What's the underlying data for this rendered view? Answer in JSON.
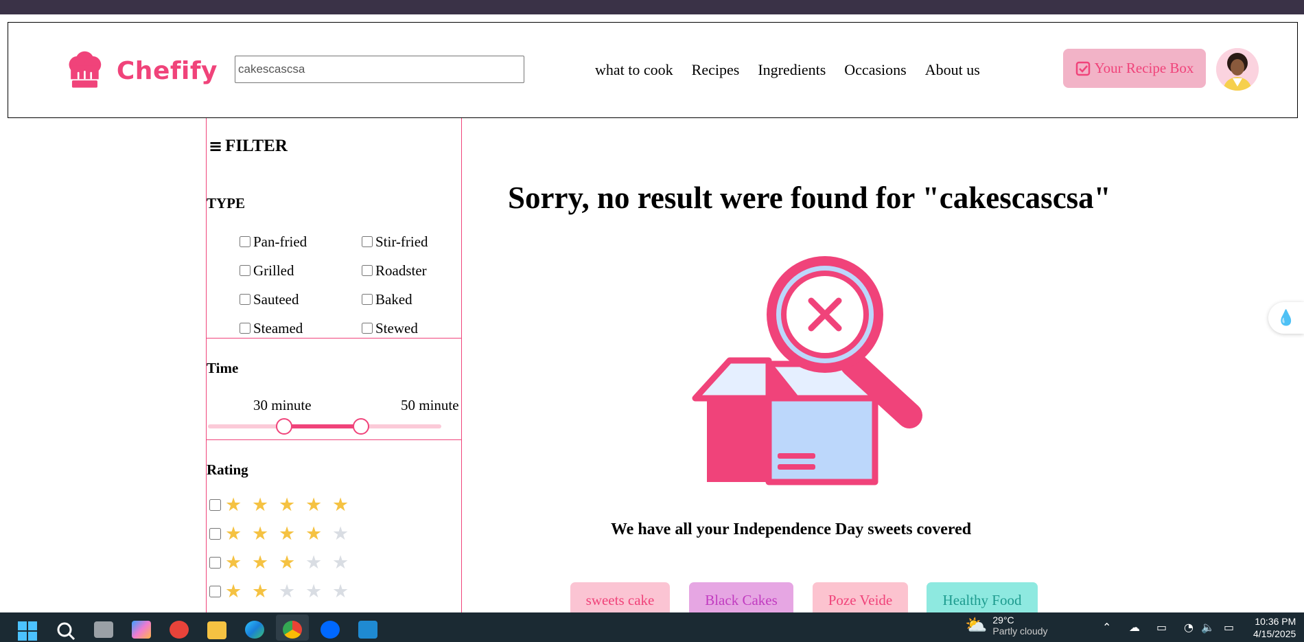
{
  "header": {
    "logo_text": "Chefify",
    "search_value": "cakescascsa",
    "nav": [
      "what to cook",
      "Recipes",
      "Ingredients",
      "Occasions",
      "About us"
    ],
    "recipe_box_label": "Your Recipe Box"
  },
  "filter": {
    "title": "FILTER",
    "type_title": "TYPE",
    "types": [
      "Pan-fried",
      "Stir-fried",
      "Grilled",
      "Roadster",
      "Sauteed",
      "Baked",
      "Steamed",
      "Stewed"
    ],
    "time_title": "Time",
    "time_min_label": "30 minute",
    "time_max_label": "50 minute",
    "time_range_min": 30,
    "time_range_max": 50,
    "rating_title": "Rating",
    "ratings": [
      5,
      4,
      3,
      2
    ]
  },
  "main": {
    "heading": "Sorry, no result were found for \"cakescascsa\"",
    "subtitle": "We have all your Independence Day sweets covered",
    "tags": [
      {
        "label": "sweets cake",
        "bg": "#fbc4d3",
        "fg": "#f0437a"
      },
      {
        "label": "Black Cakes",
        "bg": "#e6a6e3",
        "fg": "#c13bc0"
      },
      {
        "label": "Poze Veide",
        "bg": "#fcc3cf",
        "fg": "#f0437a"
      },
      {
        "label": "Healthy Food",
        "bg": "#8ee9e0",
        "fg": "#1d9b8e"
      }
    ]
  },
  "colors": {
    "accent": "#f0437a",
    "star": "#f5c242",
    "star_off": "#d9dde3",
    "box_blue": "#bcd7fb"
  },
  "taskbar": {
    "temperature": "29°C",
    "weather": "Partly cloudy",
    "time": "10:36 PM",
    "date": "4/15/2025"
  }
}
